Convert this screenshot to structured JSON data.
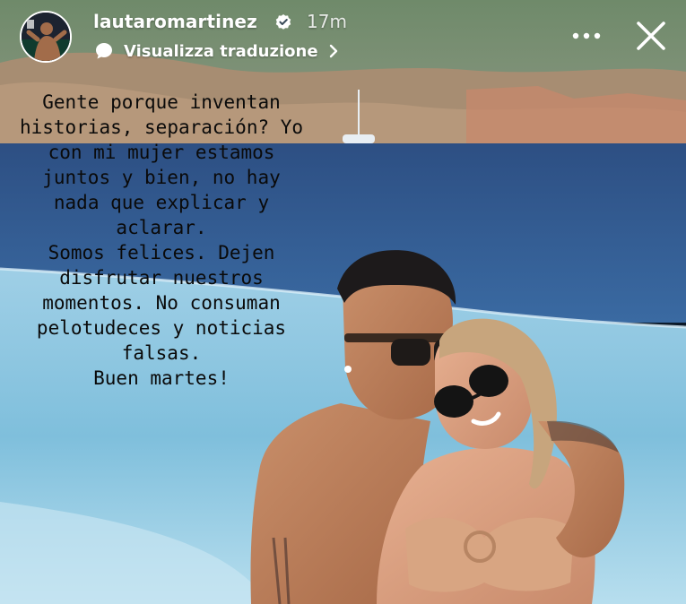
{
  "story": {
    "username": "lautaromartinez",
    "verified": true,
    "time_ago": "17m",
    "translate_label": "Visualizza traduzione",
    "caption": "Gente porque inventan\nhistorias, separación? Yo\ncon mi mujer estamos\njuntos y bien, no hay\nnada que explicar y\naclarar.\nSomos felices. Dejen\ndisfrutar nuestros\nmomentos. No consuman\npelotudeces y noticias\nfalsas.\nBuen martes!",
    "icons": {
      "verified": "verified-badge-icon",
      "translate": "speech-bubble-icon",
      "chevron": "chevron-right-icon",
      "more": "more-horizontal-icon",
      "close": "close-icon"
    },
    "colors": {
      "header_text": "#ffffff",
      "caption_text": "#0a0a0a",
      "verified_badge": "#ffffff"
    }
  }
}
